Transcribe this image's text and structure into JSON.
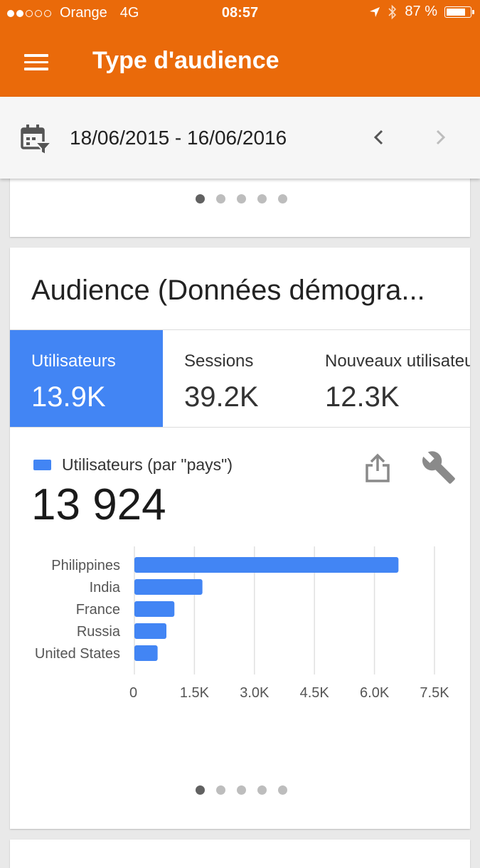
{
  "status_bar": {
    "carrier": "Orange",
    "network": "4G",
    "time": "08:57",
    "battery": "87 %",
    "battery_level": 0.87
  },
  "app_bar": {
    "title": "Type d'audience"
  },
  "date_bar": {
    "range": "18/06/2015 - 16/06/2016"
  },
  "card": {
    "title": "Audience (Données démogra...",
    "tabs": [
      {
        "label": "Utilisateurs",
        "value": "13.9K"
      },
      {
        "label": "Sessions",
        "value": "39.2K"
      },
      {
        "label": "Nouveaux utilisateurs",
        "value": "12.3K"
      }
    ],
    "legend": "Utilisateurs (par \"pays\")",
    "total": "13 924",
    "accent_color": "#4285f4"
  },
  "chart_data": {
    "type": "bar",
    "orientation": "horizontal",
    "categories": [
      "Philippines",
      "India",
      "France",
      "Russia",
      "United States"
    ],
    "values": [
      6600,
      1700,
      1000,
      800,
      580
    ],
    "x_ticks": [
      "0",
      "1.5K",
      "3.0K",
      "4.5K",
      "6.0K",
      "7.5K"
    ],
    "xlim": [
      0,
      7500
    ],
    "grid": true,
    "color": "#4285f4"
  },
  "colors": {
    "brand": "#ea6a0a",
    "accent": "#4285f4"
  },
  "icons": {
    "menu": "menu-icon",
    "calendar": "calendar-filter-icon",
    "share": "share-icon",
    "settings": "wrench-icon"
  }
}
